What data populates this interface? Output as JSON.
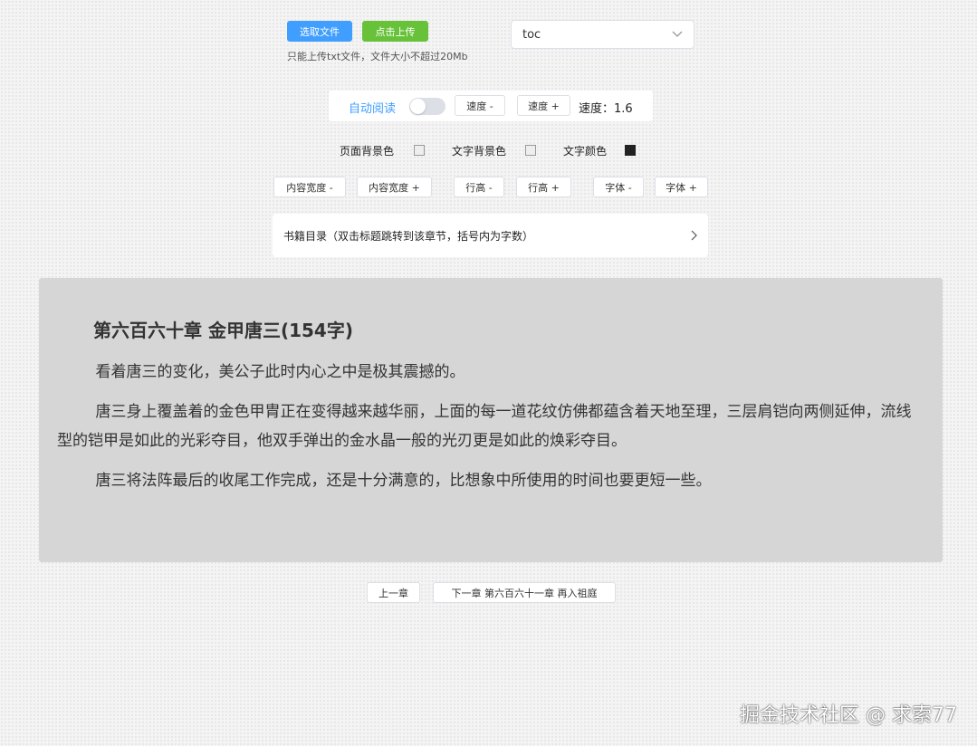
{
  "upload": {
    "select_file_label": "选取文件",
    "upload_label": "点击上传",
    "hint": "只能上传txt文件，文件大小不超过20Mb"
  },
  "book_select": {
    "selected_value": "toc"
  },
  "auto_read": {
    "label": "自动阅读",
    "speed_minus": "速度 -",
    "speed_plus": "速度 +",
    "speed_label": "速度：",
    "speed_value": "1.6"
  },
  "colors": {
    "page_bg_label": "页面背景色",
    "text_bg_label": "文字背景色",
    "text_color_label": "文字颜色",
    "accent": "#409eff",
    "upload_green": "#67c23a",
    "reader_bg": "#d6d6d6"
  },
  "layout_controls": {
    "width_minus": "内容宽度 -",
    "width_plus": "内容宽度 +",
    "line_height_minus": "行高 -",
    "line_height_plus": "行高 +",
    "font_minus": "字体 -",
    "font_plus": "字体 +"
  },
  "toc": {
    "label": "书籍目录（双击标题跳转到该章节，括号内为字数）"
  },
  "chapter": {
    "title": "第六百六十章 金甲唐三(154字)",
    "paragraphs": [
      "看着唐三的变化，美公子此时内心之中是极其震撼的。",
      "唐三身上覆盖着的金色甲胄正在变得越来越华丽，上面的每一道花纹仿佛都蕴含着天地至理，三层肩铠向两侧延伸，流线型的铠甲是如此的光彩夺目，他双手弹出的金水晶一般的光刃更是如此的焕彩夺目。",
      "唐三将法阵最后的收尾工作完成，还是十分满意的，比想象中所使用的时间也要更短一些。"
    ]
  },
  "nav": {
    "prev_label": "上一章",
    "next_label": "下一章 第六百六十一章 再入祖庭"
  },
  "watermark": "掘金技术社区 @ 求索77"
}
